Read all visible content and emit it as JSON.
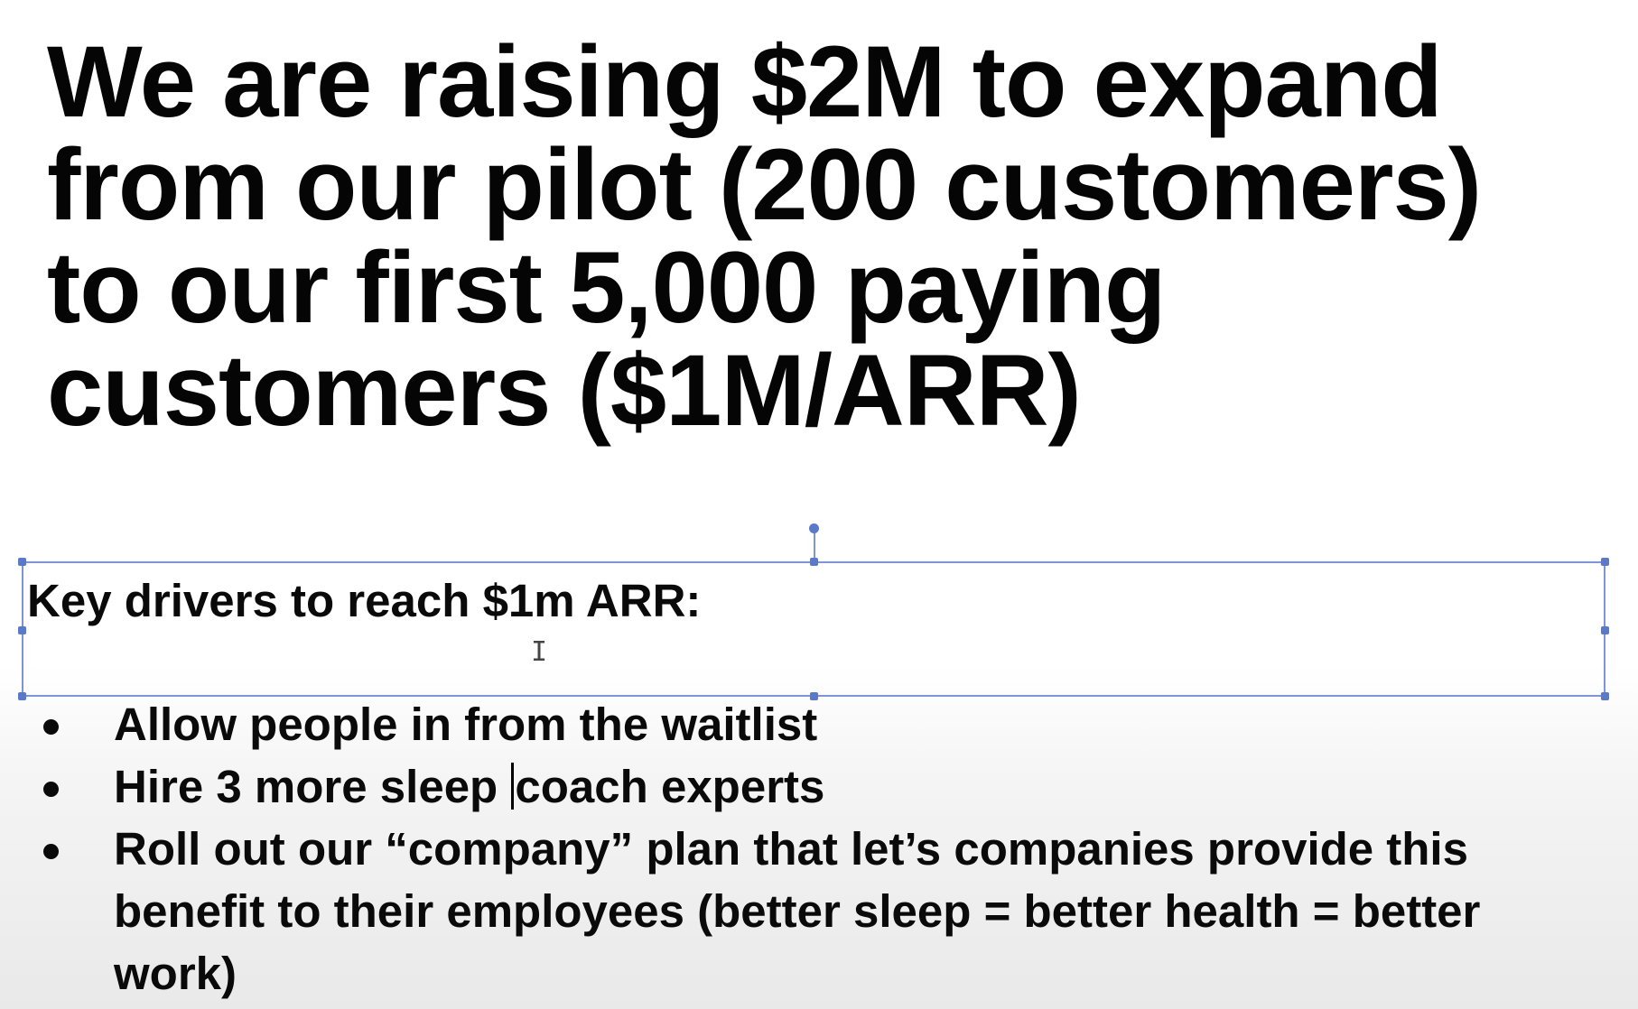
{
  "slide": {
    "headline_lines": [
      "We are raising $2M to expand",
      "from our pilot (200 customers)",
      "to our first 5,000 paying",
      "customers ($1M/ARR)"
    ],
    "textbox_label": "Key drivers to reach $1m ARR:",
    "bullets": [
      {
        "text": "Allow people in from the waitlist"
      },
      {
        "before_caret": "Hire 3 more sleep ",
        "after_caret": "coach experts"
      },
      {
        "text": "Roll out our “company” plan that let’s companies provide this benefit to their employees (better sleep = better health = better work)"
      }
    ]
  },
  "colors": {
    "selection_border": "#7d95d6",
    "selection_handle": "#5b79c9",
    "text": "#0a0a0a"
  }
}
